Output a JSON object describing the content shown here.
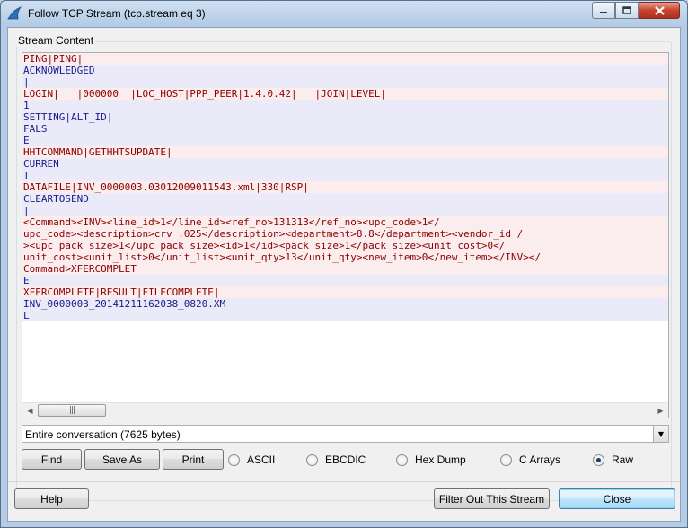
{
  "window": {
    "title": "Follow TCP Stream (tcp.stream eq 3)"
  },
  "stream": {
    "group_label": "Stream Content",
    "lines": [
      {
        "text": "PING|PING|",
        "dir": "client"
      },
      {
        "text": "ACKNOWLEDGED",
        "dir": "server"
      },
      {
        "text": "|",
        "dir": "server"
      },
      {
        "text": "LOGIN|   |000000  |LOC_HOST|PPP_PEER|1.4.0.42|   |JOIN|LEVEL|",
        "dir": "client"
      },
      {
        "text": "1",
        "dir": "server"
      },
      {
        "text": "SETTING|ALT_ID|",
        "dir": "server"
      },
      {
        "text": "FALS",
        "dir": "server"
      },
      {
        "text": "E",
        "dir": "server"
      },
      {
        "text": "HHTCOMMAND|GETHHTSUPDATE|",
        "dir": "client"
      },
      {
        "text": "CURREN",
        "dir": "server"
      },
      {
        "text": "T",
        "dir": "server"
      },
      {
        "text": "DATAFILE|INV_0000003.03012009011543.xml|330|RSP|",
        "dir": "client"
      },
      {
        "text": "CLEARTOSEND",
        "dir": "server"
      },
      {
        "text": "|",
        "dir": "server"
      },
      {
        "text": "<Command><INV><line_id>1</line_id><ref_no>131313</ref_no><upc_code>1</",
        "dir": "client"
      },
      {
        "text": "upc_code><description>crv .025</description><department>8.8</department><vendor_id /",
        "dir": "client"
      },
      {
        "text": "><upc_pack_size>1</upc_pack_size><id>1</id><pack_size>1</pack_size><unit_cost>0</",
        "dir": "client"
      },
      {
        "text": "unit_cost><unit_list>0</unit_list><unit_qty>13</unit_qty><new_item>0</new_item></INV></",
        "dir": "client"
      },
      {
        "text": "Command>XFERCOMPLET",
        "dir": "client"
      },
      {
        "text": "E",
        "dir": "server"
      },
      {
        "text": "XFERCOMPLETE|RESULT|FILECOMPLETE|",
        "dir": "client"
      },
      {
        "text": "INV_0000003_20141211162038_0820.XM",
        "dir": "server"
      },
      {
        "text": "L",
        "dir": "server"
      }
    ]
  },
  "conversation_select": {
    "value": "Entire conversation (7625 bytes)"
  },
  "buttons": {
    "find": "Find",
    "save_as": "Save As",
    "print": "Print",
    "help": "Help",
    "filter_out": "Filter Out This Stream",
    "close": "Close"
  },
  "formats": [
    {
      "label": "ASCII",
      "checked": false
    },
    {
      "label": "EBCDIC",
      "checked": false
    },
    {
      "label": "Hex Dump",
      "checked": false
    },
    {
      "label": "C Arrays",
      "checked": false
    },
    {
      "label": "Raw",
      "checked": true
    }
  ],
  "colors": {
    "client_text": "#8b0000",
    "client_bg": "#fbeded",
    "server_text": "#1a1a8b",
    "server_bg": "#eaeaf8"
  },
  "icons": {
    "app": "wireshark-fin-icon",
    "minimize": "minimize-icon",
    "maximize": "maximize-icon",
    "close": "close-icon",
    "scroll_left": "arrow-left-icon",
    "scroll_right": "arrow-right-icon",
    "dropdown": "chevron-down-icon"
  }
}
